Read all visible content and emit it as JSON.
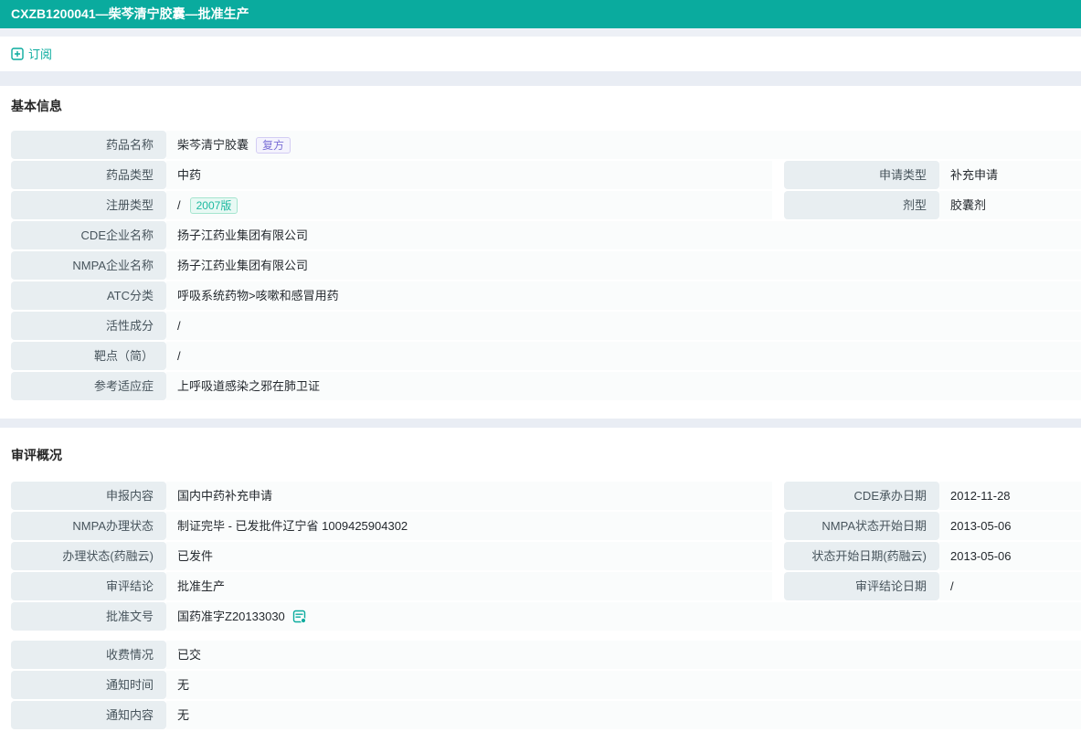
{
  "page": {
    "title": "CXZB1200041—柴芩清宁胶囊—批准生产",
    "subscribe_label": "订阅"
  },
  "colors": {
    "accent": "#0aab9e",
    "label_cell_bg": "#e8eef1",
    "value_cell_bg": "#fafcfc",
    "divider_band": "#e9edf4",
    "badge_compound": "#7b70d6",
    "badge_version": "#1db9a0"
  },
  "icons": {
    "subscribe": "add-square-icon",
    "approval_doc": "document-detail-icon"
  },
  "basic_info": {
    "title": "基本信息",
    "rows": [
      {
        "label": "药品名称",
        "value": "柴芩清宁胶囊",
        "badge": "复方"
      },
      {
        "label": "药品类型",
        "value": "中药",
        "right_label": "申请类型",
        "right_value": "补充申请"
      },
      {
        "label": "注册类型",
        "value": "/",
        "badge": "2007版",
        "right_label": "剂型",
        "right_value": "胶囊剂"
      },
      {
        "label": "CDE企业名称",
        "value": "扬子江药业集团有限公司"
      },
      {
        "label": "NMPA企业名称",
        "value": "扬子江药业集团有限公司"
      },
      {
        "label": "ATC分类",
        "value": "呼吸系统药物>咳嗽和感冒用药"
      },
      {
        "label": "活性成分",
        "value": "/"
      },
      {
        "label": "靶点（简）",
        "value": "/"
      },
      {
        "label": "参考适应症",
        "value": "上呼吸道感染之邪在肺卫证"
      }
    ]
  },
  "review": {
    "title": "审评概况",
    "rows": [
      {
        "label": "申报内容",
        "value": "国内中药补充申请",
        "right_label": "CDE承办日期",
        "right_value": "2012-11-28"
      },
      {
        "label": "NMPA办理状态",
        "value": "制证完毕 - 已发批件辽宁省 1009425904302",
        "right_label": "NMPA状态开始日期",
        "right_value": "2013-05-06"
      },
      {
        "label": "办理状态(药融云)",
        "value": "已发件",
        "right_label": "状态开始日期(药融云)",
        "right_value": "2013-05-06"
      },
      {
        "label": "审评结论",
        "value": "批准生产",
        "right_label": "审评结论日期",
        "right_value": "/"
      },
      {
        "label": "批准文号",
        "value": "国药准字Z20133030"
      }
    ],
    "rows_extra": [
      {
        "label": "收费情况",
        "value": "已交"
      },
      {
        "label": "通知时间",
        "value": "无"
      },
      {
        "label": "通知内容",
        "value": "无"
      }
    ]
  }
}
